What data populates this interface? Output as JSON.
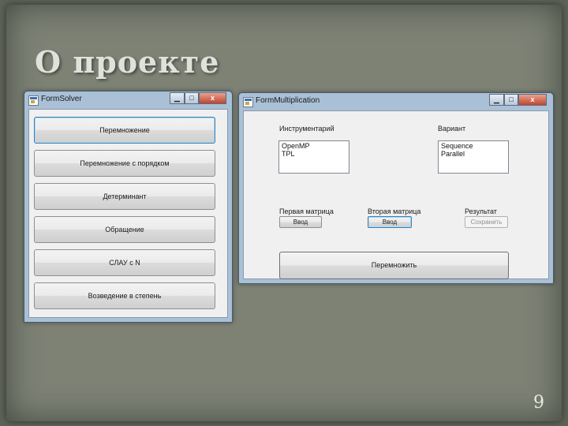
{
  "slide": {
    "title": "О проекте",
    "page_number": "9"
  },
  "form_solver": {
    "title": "FormSolver",
    "controls": {
      "minimize": "▁",
      "maximize": "□",
      "close": "x"
    },
    "buttons": [
      "Перемножение",
      "Перемножение с порядком",
      "Детерминант",
      "Обращение",
      "СЛАУ с N",
      "Возведение в степень"
    ]
  },
  "form_multiplication": {
    "title": "FormMultiplication",
    "controls": {
      "minimize": "▁",
      "maximize": "□",
      "close": "x"
    },
    "tools_label": "Инструментарий",
    "tools_items": [
      "OpenMP",
      "TPL"
    ],
    "variant_label": "Вариант",
    "variant_items": [
      "Sequence",
      "Parallel"
    ],
    "first_matrix_label": "Первая матрица",
    "first_input_button": "Ввод",
    "second_matrix_label": "Вторая матрица",
    "second_input_button": "Ввод",
    "result_label": "Результат",
    "result_button": "Сохранить",
    "multiply_button": "Перемножить"
  }
}
